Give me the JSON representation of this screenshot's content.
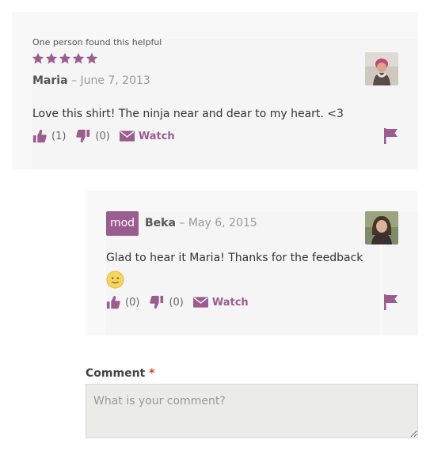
{
  "review": {
    "helpful_text": "One person found this helpful",
    "rating": 5,
    "rating_max": 5,
    "author": "Maria",
    "date_sep": "–",
    "date": "June 7, 2013",
    "text": "Love this shirt! The ninja near and dear to my heart. <3",
    "upvotes": "(1)",
    "downvotes": "(0)",
    "watch_label": "Watch"
  },
  "reply": {
    "badge": "mod",
    "author": "Beka",
    "date_sep": "–",
    "date": "May 6, 2015",
    "text": "Glad to hear it Maria! Thanks for the feedback",
    "upvotes": "(0)",
    "downvotes": "(0)",
    "watch_label": "Watch"
  },
  "comment_form": {
    "label": "Comment",
    "required_mark": "*",
    "placeholder": "What is your comment?"
  },
  "colors": {
    "accent": "#9b5c8f",
    "required": "#e2401c"
  },
  "icons": [
    "star-icon",
    "thumbs-up-icon",
    "thumbs-down-icon",
    "envelope-icon",
    "flag-icon",
    "smiley-icon"
  ]
}
